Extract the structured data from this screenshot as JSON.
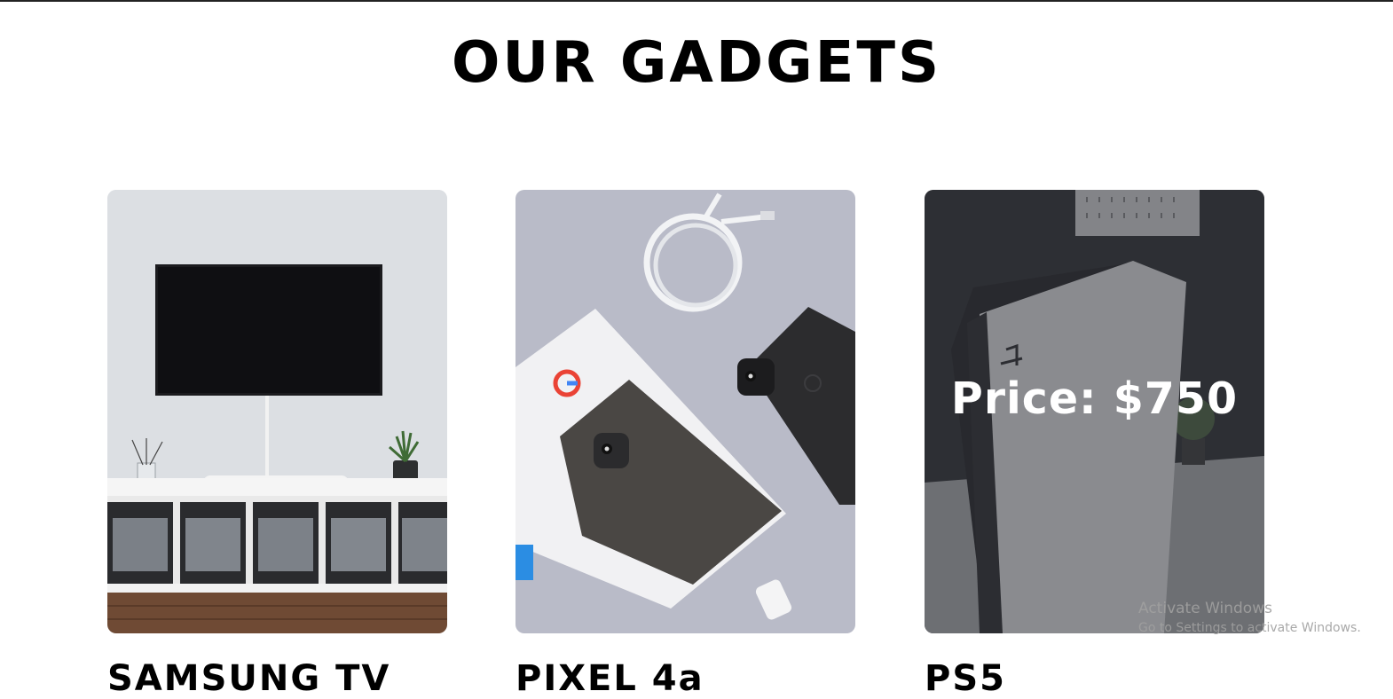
{
  "page": {
    "title": "OUR GADGETS"
  },
  "products": [
    {
      "name": "SAMSUNG TV",
      "image": "tv-wall-photo",
      "price_label": ""
    },
    {
      "name": "PIXEL 4a",
      "image": "pixel-phone-photo",
      "price_label": ""
    },
    {
      "name": "PS5",
      "image": "ps5-console-photo",
      "price_label": "Price: $750"
    }
  ],
  "watermark": {
    "line1": "Activate Windows",
    "line2": "Go to Settings to activate Windows."
  }
}
